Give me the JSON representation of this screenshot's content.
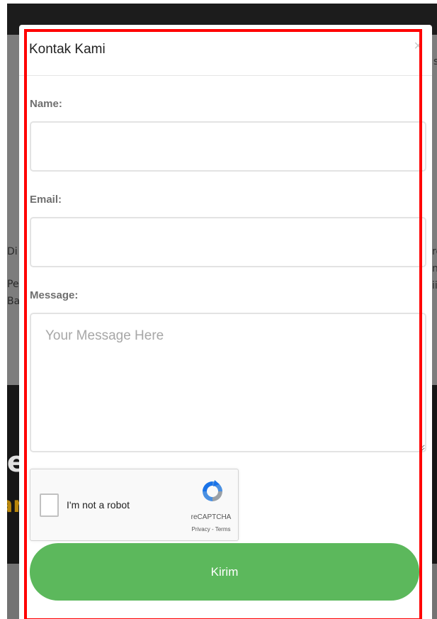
{
  "background": {
    "fragments": [
      "s",
      "Di",
      "Pe",
      "Ba",
      "ro",
      "n",
      "ii",
      "le",
      "ar"
    ]
  },
  "modal": {
    "title": "Kontak Kami",
    "close_symbol": "×"
  },
  "form": {
    "name_label": "Name:",
    "name_value": "",
    "email_label": "Email:",
    "email_value": "",
    "message_label": "Message:",
    "message_placeholder": "Your Message Here",
    "message_value": ""
  },
  "recaptcha": {
    "label": "I'm not a robot",
    "checked": false,
    "brand": "reCAPTCHA",
    "privacy": "Privacy",
    "separator": " - ",
    "terms": "Terms"
  },
  "submit": {
    "label": "Kirim"
  },
  "colors": {
    "submit_bg": "#5cb85c",
    "highlight_border": "#ff0000",
    "overlay": "#7d7d7d"
  }
}
